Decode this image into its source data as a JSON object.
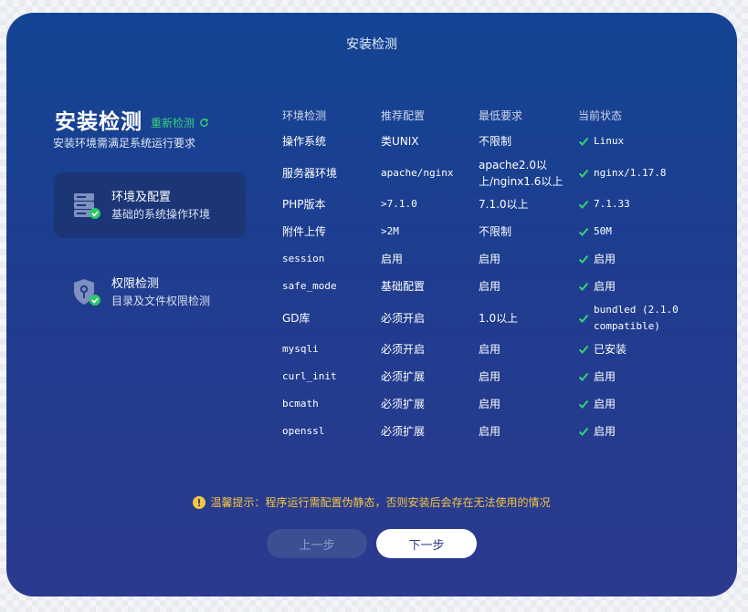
{
  "window_title": "安装检测",
  "heading": {
    "title": "安装检测",
    "recheck_label": "重新检测",
    "subtitle": "安装环境需满足系统运行要求"
  },
  "steps": [
    {
      "title": "环境及配置",
      "desc": "基础的系统操作环境",
      "icon": "server-icon",
      "active": true
    },
    {
      "title": "权限检测",
      "desc": "目录及文件权限检测",
      "icon": "shield-key-icon",
      "active": false
    }
  ],
  "table": {
    "headers": [
      "环境检测",
      "推荐配置",
      "最低要求",
      "当前状态"
    ],
    "rows": [
      {
        "item": "操作系统",
        "recommended": "类UNIX",
        "minimum": "不限制",
        "status": "Linux"
      },
      {
        "item": "服务器环境",
        "recommended": "apache/nginx",
        "minimum": "apache2.0以上/nginx1.6以上",
        "status": "nginx/1.17.8"
      },
      {
        "item": "PHP版本",
        "recommended": ">7.1.0",
        "minimum": "7.1.0以上",
        "status": "7.1.33"
      },
      {
        "item": "附件上传",
        "recommended": ">2M",
        "minimum": "不限制",
        "status": "50M"
      },
      {
        "item": "session",
        "recommended": "启用",
        "minimum": "启用",
        "status": "启用"
      },
      {
        "item": "safe_mode",
        "recommended": "基础配置",
        "minimum": "启用",
        "status": "启用"
      },
      {
        "item": "GD库",
        "recommended": "必须开启",
        "minimum": "1.0以上",
        "status": "bundled (2.1.0 compatible)"
      },
      {
        "item": "mysqli",
        "recommended": "必须开启",
        "minimum": "启用",
        "status": "已安装"
      },
      {
        "item": "curl_init",
        "recommended": "必须扩展",
        "minimum": "启用",
        "status": "启用"
      },
      {
        "item": "bcmath",
        "recommended": "必须扩展",
        "minimum": "启用",
        "status": "启用"
      },
      {
        "item": "openssl",
        "recommended": "必须扩展",
        "minimum": "启用",
        "status": "启用"
      }
    ]
  },
  "notice": "温馨提示：程序运行需配置伪静态，否则安装后会存在无法使用的情况",
  "buttons": {
    "prev": "上一步",
    "next": "下一步"
  },
  "colors": {
    "panel_top": "#134493",
    "panel_bottom": "#2b3a8e",
    "accent_green": "#35d37a",
    "warning_yellow": "#f4c542",
    "active_step_bg": "#1b3577"
  }
}
